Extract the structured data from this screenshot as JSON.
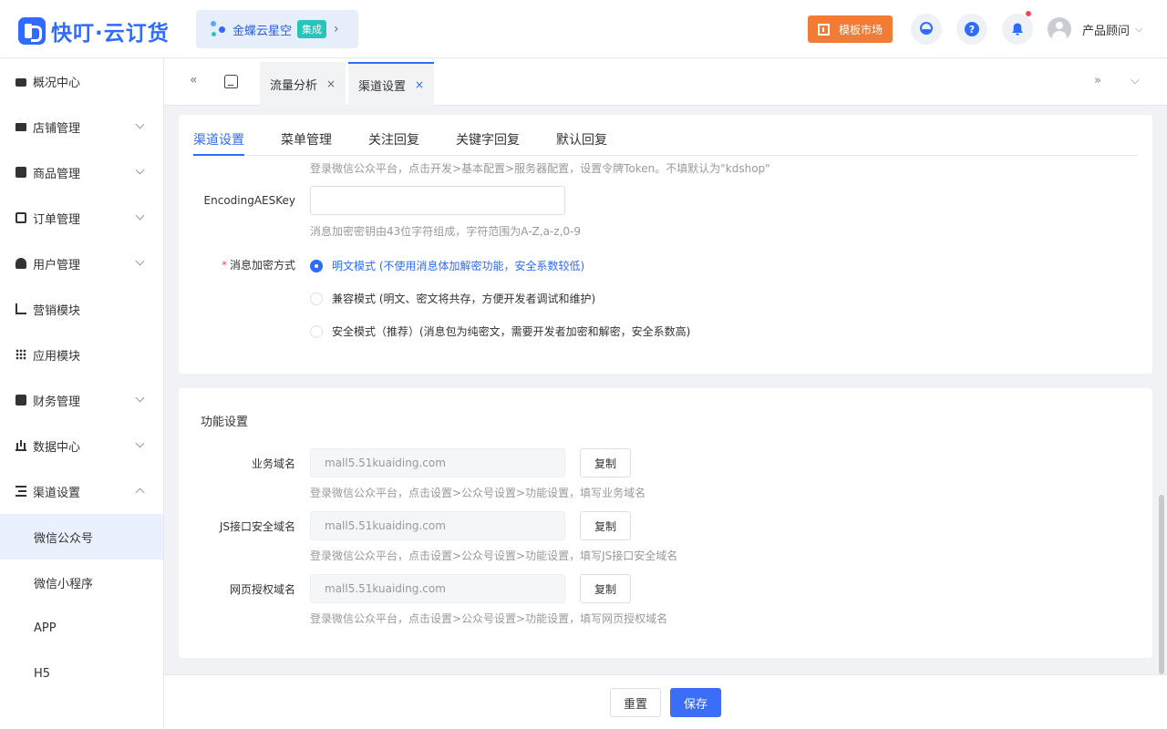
{
  "app": {
    "logo_text": "快叮·云订货"
  },
  "header": {
    "integration_name": "金蝶云星空",
    "integration_badge": "集成",
    "market_button": "模板市场",
    "help_icon_text": "?",
    "user_name": "产品顾问"
  },
  "sidebar": {
    "items": [
      {
        "label": "概况中心",
        "icon": "lock-icon"
      },
      {
        "label": "店铺管理",
        "icon": "store-icon"
      },
      {
        "label": "商品管理",
        "icon": "bag-icon"
      },
      {
        "label": "订单管理",
        "icon": "clipboard-icon"
      },
      {
        "label": "用户管理",
        "icon": "user-icon"
      },
      {
        "label": "营销模块",
        "icon": "trend-icon"
      },
      {
        "label": "应用模块",
        "icon": "grid-icon"
      },
      {
        "label": "财务管理",
        "icon": "wallet-icon"
      },
      {
        "label": "数据中心",
        "icon": "bar-chart-icon"
      },
      {
        "label": "渠道设置",
        "icon": "list-icon"
      }
    ],
    "subitems": [
      "微信公众号",
      "微信小程序",
      "APP",
      "H5"
    ]
  },
  "tabstrip": {
    "tabs": [
      {
        "label": "流量分析"
      },
      {
        "label": "渠道设置"
      }
    ],
    "close_glyph": "×"
  },
  "inner_tabs": [
    "渠道设置",
    "菜单管理",
    "关注回复",
    "关键字回复",
    "默认回复"
  ],
  "server_config": {
    "token_hint": "登录微信公众平台，点击开发>基本配置>服务器配置，设置令牌Token。不填默认为\"kdshop\"",
    "aes_label": "EncodingAESKey",
    "aes_value": "",
    "aes_hint": "消息加密密钥由43位字符组成，字符范围为A-Z,a-z,0-9",
    "encrypt_label": "消息加密方式",
    "encrypt_required_mark": "*",
    "encrypt_options": [
      "明文模式 (不使用消息体加解密功能，安全系数较低)",
      "兼容模式 (明文、密文将共存，方便开发者调试和维护)",
      "安全模式（推荐）(消息包为纯密文，需要开发者加密和解密，安全系数高)"
    ],
    "encrypt_selected_index": 0
  },
  "function_settings": {
    "title": "功能设置",
    "copy_label": "复制",
    "rows": [
      {
        "label": "业务域名",
        "value": "mall5.51kuaiding.com",
        "hint": "登录微信公众平台，点击设置>公众号设置>功能设置，填写业务域名"
      },
      {
        "label": "JS接口安全域名",
        "value": "mall5.51kuaiding.com",
        "hint": "登录微信公众平台，点击设置>公众号设置>功能设置，填写JS接口安全域名"
      },
      {
        "label": "网页授权域名",
        "value": "mall5.51kuaiding.com",
        "hint": "登录微信公众平台，点击设置>公众号设置>功能设置，填写网页授权域名"
      }
    ]
  },
  "footer": {
    "reset_label": "重置",
    "save_label": "保存"
  },
  "colors": {
    "accent": "#2f6bff",
    "market": "#f27b36",
    "badge": "#28c3b9",
    "required": "#f5485a"
  }
}
